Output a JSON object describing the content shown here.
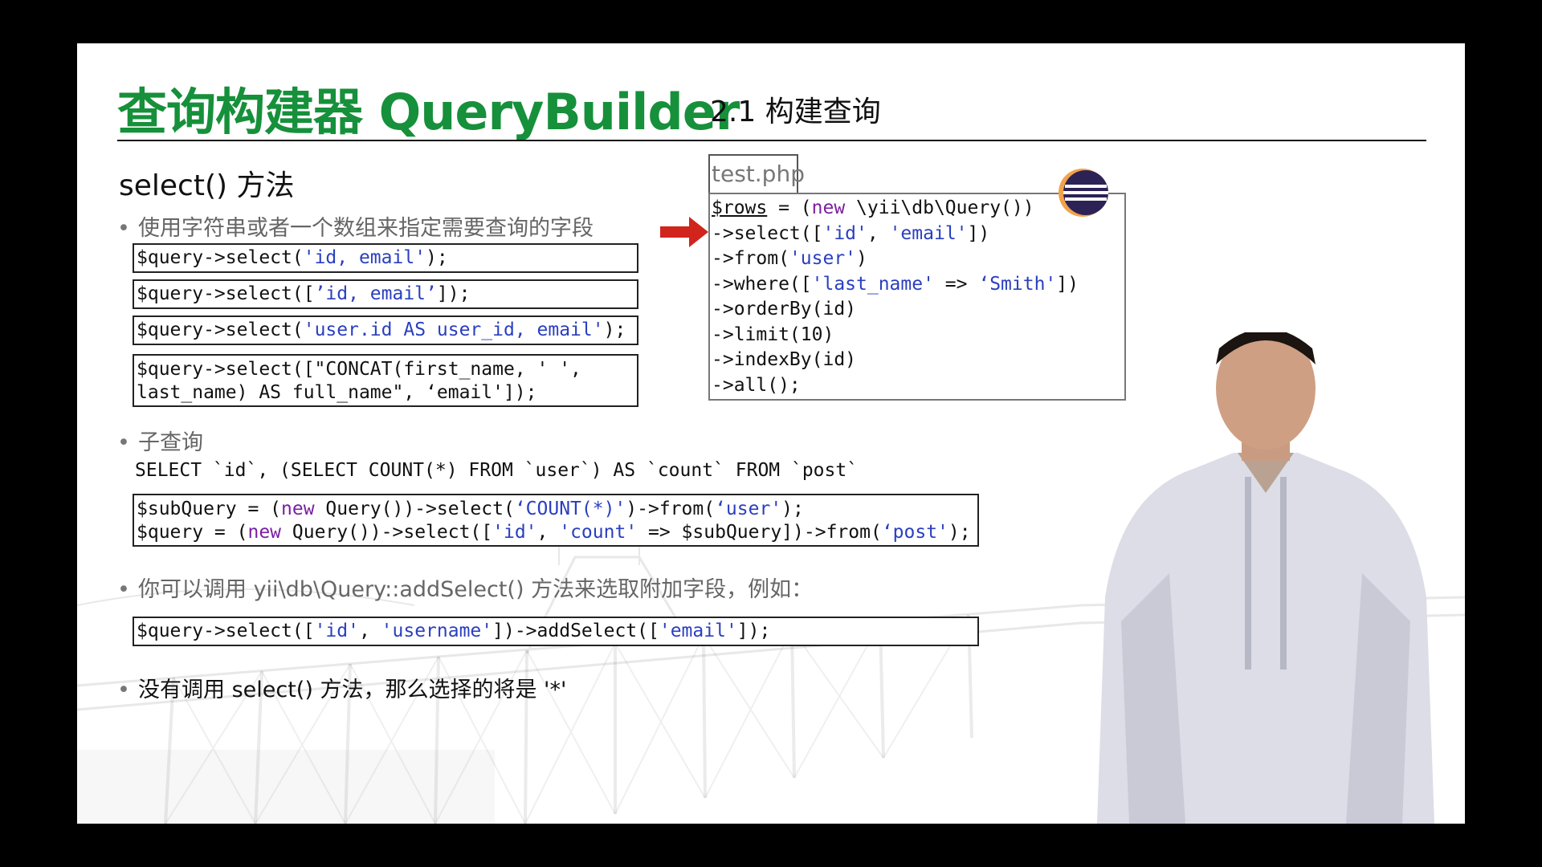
{
  "slide": {
    "title": "查询构建器 QueryBuilder",
    "subtitle": "2.1 构建查询",
    "section_heading": "select() 方法"
  },
  "bullets": {
    "b1": "使用字符串或者一个数组来指定需要查询的字段",
    "b2": "子查询",
    "b3": "你可以调用 yii\\db\\Query::addSelect() 方法来选取附加字段，例如：",
    "b4": "没有调用 select() 方法，那么选择的将是 '*'"
  },
  "examples": {
    "ex1": {
      "a": "$query->select(",
      "b": "'id, email'",
      "c": ");"
    },
    "ex2": {
      "a": "$query->select([",
      "b": "’id, email’",
      "c": "]);"
    },
    "ex3": {
      "a": "$query->select(",
      "b": "'user.id AS user_id, email'",
      "c": ");"
    },
    "ex4": {
      "line1": "$query->select([\"CONCAT(first_name, ' ',",
      "line2": "last_name) AS full_name\", ‘email']);"
    }
  },
  "subquery": {
    "sql": "SELECT `id`, (SELECT COUNT(*) FROM `user`) AS `count` FROM `post`",
    "l1": {
      "a": "$subQuery = (",
      "b": "new",
      "c": " Query())->select(",
      "d": "‘COUNT(*)'",
      "e": ")->from(",
      "f": "‘user'",
      "g": ");"
    },
    "l2": {
      "a": "$query = (",
      "b": "new",
      "c": " Query())->select([",
      "d": "'id'",
      "e": ", ",
      "f": "'count'",
      "g": " => $subQuery])->from(",
      "h": "‘post'",
      "i": ");"
    }
  },
  "add_select": {
    "a": "$query->select([",
    "b": "'id'",
    "c": ", ",
    "d": "'username'",
    "e": "])->addSelect([",
    "f": "'email'",
    "g": "]);"
  },
  "editor": {
    "tab_label": "test.php",
    "l1": {
      "a": "$rows",
      "b": " = (",
      "c": "new",
      "d": " \\yii\\db\\Query())"
    },
    "l2": {
      "a": "->select([",
      "b": "'id'",
      "c": ", ",
      "d": "'email'",
      "e": "])"
    },
    "l3": {
      "a": "->from(",
      "b": "'user'",
      "c": ")"
    },
    "l4": {
      "a": "->where([",
      "b": "'last_name'",
      "c": " => ",
      "d": "‘Smith'",
      "e": "])"
    },
    "l5": "->orderBy(id)",
    "l6": "->limit(10)",
    "l7": "->indexBy(id)",
    "l8": "->all();"
  },
  "colors": {
    "title_green": "#16903a",
    "keyword_purple": "#7b1fa2",
    "string_blue": "#2a3fbf",
    "arrow_red": "#d0241c"
  },
  "icons": {
    "eclipse": "eclipse-ide-icon",
    "arrow": "red-arrow-icon"
  }
}
